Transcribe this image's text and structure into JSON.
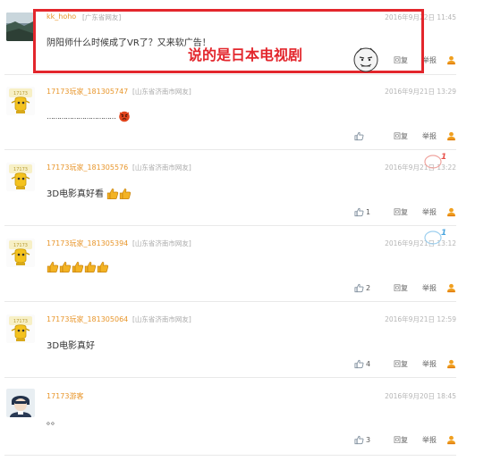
{
  "annotation": {
    "text": "说的是日本电视剧"
  },
  "actions": {
    "reply": "回复",
    "report": "举报"
  },
  "comments": [
    {
      "username": "kk_hoho",
      "location": "[广东省网友]",
      "time": "2016年9月22日 11:45",
      "text": "阴阳师什么时候成了VR了？又来软广告！",
      "likes": ""
    },
    {
      "username": "17173玩家_181305747",
      "location": "[山东省济南市网友]",
      "time": "2016年9月21日 13:29",
      "text": "……………………………",
      "likes": ""
    },
    {
      "username": "17173玩家_181305576",
      "location": "[山东省济南市网友]",
      "time": "2016年9月21日 13:22",
      "text": "3D电影真好看",
      "likes": "1",
      "badge": "1"
    },
    {
      "username": "17173玩家_181305394",
      "location": "[山东省济南市网友]",
      "time": "2016年9月21日 13:12",
      "text": "",
      "likes": "2",
      "badge": "1"
    },
    {
      "username": "17173玩家_181305064",
      "location": "[山东省济南市网友]",
      "time": "2016年9月21日 12:59",
      "text": "3D电影真好",
      "likes": "4"
    },
    {
      "username": "17173游客",
      "location": "",
      "time": "2016年9月20日 18:45",
      "text": "。。",
      "likes": "3"
    }
  ],
  "icons": {
    "like": "thumbs-up-outline-icon",
    "share": "person-share-icon",
    "emoji_thumb": "thumbs-up-emoji-icon",
    "emoji_angry": "angry-face-emoji-icon"
  },
  "colors": {
    "username": "#e8962b",
    "highlight": "#e3262c",
    "share_icon": "#f0a020"
  }
}
